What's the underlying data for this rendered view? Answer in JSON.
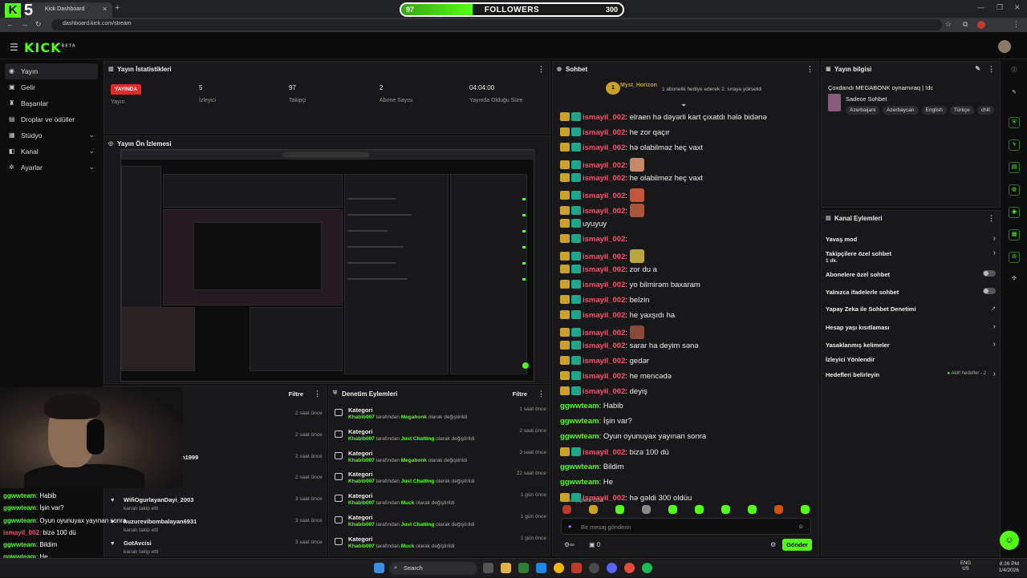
{
  "browser": {
    "tab_title": "Kick Dashboard",
    "url": "dashboard.kick.com/stream"
  },
  "overlay": {
    "logo_number": "5",
    "goal": {
      "current": "97",
      "label": "FOLLOWERS",
      "target": "300",
      "progress_fraction": 0.323
    }
  },
  "app": {
    "logo": "KICK",
    "logo_sup": "BETA"
  },
  "sidebar": {
    "items": [
      {
        "label": "Yayın",
        "icon": "broadcast-icon",
        "active": true
      },
      {
        "label": "Gelir",
        "icon": "money-icon"
      },
      {
        "label": "Başarılar",
        "icon": "trophy-icon"
      },
      {
        "label": "Droplar ve ödüller",
        "icon": "gift-icon"
      },
      {
        "label": "Stüdyo",
        "icon": "studio-icon",
        "expandable": true
      },
      {
        "label": "Kanal",
        "icon": "channel-icon",
        "expandable": true
      },
      {
        "label": "Ayarlar",
        "icon": "gear-icon",
        "expandable": true
      }
    ]
  },
  "stats": {
    "title": "Yayın İstatistikleri",
    "live_badge": "YAYINDA",
    "live_label": "Yayın",
    "viewers_value": "5",
    "viewers_label": "İzleyici",
    "followers_value": "97",
    "followers_label": "Takipçi",
    "subs_value": "2",
    "subs_label": "Abone Sayısı",
    "duration_value": "04:04:00",
    "duration_label": "Yayında Olduğu Süre"
  },
  "preview": {
    "title": "Yayın Ön İzlemesi"
  },
  "followers_panel": {
    "filter": "Filtre",
    "rows": [
      {
        "name": "",
        "sub": "",
        "time": "2 saat önce"
      },
      {
        "name": "",
        "sub": "",
        "time": "2 saat önce"
      },
      {
        "name": "n1999",
        "sub": "",
        "time": "2 saat önce"
      },
      {
        "name": "",
        "sub": "",
        "time": "2 saat önce"
      },
      {
        "name": "WifiOgurlayanDayi_2003",
        "sub": "kanalı takip etti",
        "time": "3 saat önce"
      },
      {
        "name": "huzurevibombalayan6931",
        "sub": "kanalı takip etti",
        "time": "3 saat önce"
      },
      {
        "name": "GotAvcisi",
        "sub": "kanalı takip etti",
        "time": "3 saat önce"
      }
    ]
  },
  "moderation": {
    "title": "Denetim Eylemleri",
    "filter": "Filtre",
    "rows": [
      {
        "title": "Kategori",
        "user": "Khabib007",
        "pre": " tarafından ",
        "cat": "Megabonk",
        "post": " olarak değiştirildi",
        "time": "1 saat önce"
      },
      {
        "title": "Kategori",
        "user": "Khabib007",
        "pre": " tarafından ",
        "cat": "Just Chatting",
        "post": " olarak değiştirildi",
        "time": "2 saat önce"
      },
      {
        "title": "Kategori",
        "user": "Khabib007",
        "pre": " tarafından ",
        "cat": "Megabonk",
        "post": " olarak değiştirildi",
        "time": "3 saat önce"
      },
      {
        "title": "Kategori",
        "user": "Khabib007",
        "pre": " tarafından ",
        "cat": "Just Chatting",
        "post": " olarak değiştirildi",
        "time": "22 saat önce"
      },
      {
        "title": "Kategori",
        "user": "Khabib007",
        "pre": " tarafından ",
        "cat": "Muck",
        "post": " olarak değiştirildi",
        "time": "1 gün önce"
      },
      {
        "title": "Kategori",
        "user": "Khabib007",
        "pre": " tarafından ",
        "cat": "Just Chatting",
        "post": " olarak değiştirildi",
        "time": "1 gün önce"
      },
      {
        "title": "Kategori",
        "user": "Khabib007",
        "pre": " tarafından ",
        "cat": "Muck",
        "post": " olarak değiştirildi",
        "time": "1 gün önce"
      }
    ]
  },
  "chat": {
    "title": "Sohbet",
    "pinned_user": "Myst_Horizon",
    "pinned_text": "1 abonelik hediye ederek 2. sıraya yükseldi",
    "pinned_rank": "1",
    "messages": [
      {
        "user": "ismayil_002",
        "text": ": elraen hə dəyərli kart çıxatdı hələ bidənə",
        "color": "red",
        "badges": true
      },
      {
        "user": "ismayil_002",
        "text": ": he zor qaçır",
        "color": "red",
        "badges": true
      },
      {
        "user": "ismayil_002",
        "text": ": hə olabilməz heç vaxt",
        "color": "red",
        "badges": true
      },
      {
        "user": "ismayil_002",
        "text": ":",
        "color": "red",
        "badges": true,
        "emote": "#c48a6a"
      },
      {
        "user": "ismayil_002",
        "text": ": he olabilmez heç vaxt",
        "color": "red",
        "badges": true
      },
      {
        "user": "ismayil_002",
        "text": ":",
        "color": "red",
        "badges": true,
        "emote": "#c4553a"
      },
      {
        "user": "ismayil_002",
        "text": ":",
        "color": "red",
        "badges": true,
        "emote": "#a8553a"
      },
      {
        "user": "",
        "text": "uyuyuy",
        "color": "red",
        "badges": true
      },
      {
        "user": "ismayil_002",
        "text": ":",
        "color": "red",
        "badges": true
      },
      {
        "user": "ismayil_002",
        "text": ":",
        "color": "red",
        "badges": true,
        "emote": "#b8a640"
      },
      {
        "user": "ismayil_002",
        "text": ": zor du a",
        "color": "red",
        "badges": true
      },
      {
        "user": "ismayil_002",
        "text": ": yo bilmirəm baxaram",
        "color": "red",
        "badges": true
      },
      {
        "user": "ismayil_002",
        "text": ": belzin",
        "color": "red",
        "badges": true
      },
      {
        "user": "ismayil_002",
        "text": ": he yaxşıdı ha",
        "color": "red",
        "badges": true
      },
      {
        "user": "ismayil_002",
        "text": ":",
        "color": "red",
        "badges": true,
        "emote": "#8a4a3a"
      },
      {
        "user": "ismayil_002",
        "text": ": sarar ha deyim sənə",
        "color": "red",
        "badges": true
      },
      {
        "user": "ismayil_002",
        "text": ": gedər",
        "color": "red",
        "badges": true
      },
      {
        "user": "ismayil_002",
        "text": ": he mencədə",
        "color": "red",
        "badges": true
      },
      {
        "user": "ismayil_002",
        "text": ": deyiş",
        "color": "red",
        "badges": true
      },
      {
        "user": "ggwwteam",
        "text": ": Habib",
        "color": "green",
        "badges": false
      },
      {
        "user": "ggwwteam",
        "text": ": İşin var?",
        "color": "green",
        "badges": false
      },
      {
        "user": "ggwwteam",
        "text": ": Oyun oyunuyax yayınan sonra",
        "color": "green",
        "badges": false
      },
      {
        "user": "ismayil_002",
        "text": ": bizə 100 dü",
        "color": "red",
        "badges": true
      },
      {
        "user": "ggwwteam",
        "text": ": Bildim",
        "color": "green",
        "badges": false
      },
      {
        "user": "ggwwteam",
        "text": ": He",
        "color": "green",
        "badges": false
      },
      {
        "user": "ismayil_002",
        "text": ": hə gəldi 300 oldüu",
        "color": "red",
        "badges": true
      }
    ],
    "followers_only": "Takipçilere Özel",
    "input_placeholder": "Bir mesaj gönderin",
    "send_label": "Gönder",
    "count": "0"
  },
  "overlay_chat": [
    {
      "user": "ggwwteam",
      "text": ": Habib",
      "color": "green"
    },
    {
      "user": "ggwwteam",
      "text": ": İşin var?",
      "color": "green"
    },
    {
      "user": "ggwwteam",
      "text": ": Oyun oyunuyax yayınan sonra",
      "color": "green"
    },
    {
      "user": "ismayil_002",
      "text": ": bizə 100 dü",
      "color": "red"
    },
    {
      "user": "ggwwteam",
      "text": ": Bildim",
      "color": "green"
    },
    {
      "user": "ggwwteam",
      "text": ": He",
      "color": "green"
    },
    {
      "user": "ismayil_002",
      "text": ": hə gəldi 300 oldüu",
      "color": "red"
    }
  ],
  "stream_info": {
    "title": "Yayın bilgisi",
    "stream_title": "Çoxdandı MEGABONK oynamıraq | !dc",
    "category": "Sadece Sohbet",
    "tags": [
      "Azerbaijani",
      "Azerbaycan",
      "English",
      "Türkçe",
      "chill"
    ]
  },
  "channel_actions": {
    "title": "Kanal Eylemleri",
    "items": [
      {
        "label": "Yavaş mod",
        "kind": "chevron"
      },
      {
        "label": "Takipçilere özel sohbet",
        "sub": "1 dk.",
        "kind": "chevron"
      },
      {
        "label": "Abonelere özel sohbet",
        "kind": "toggle"
      },
      {
        "label": "Yalnızca ifadelerle sohbet",
        "kind": "toggle"
      },
      {
        "label": "Yapay Zeka ile Sohbet Denetimi",
        "kind": "external"
      },
      {
        "label": "Hesap yaşı kısıtlaması",
        "kind": "chevron"
      },
      {
        "label": "Yasaklanmış kelimeler",
        "kind": "chevron"
      },
      {
        "label": "İzleyici Yönlendir",
        "kind": "none"
      },
      {
        "label": "Hedefleri belirleyin",
        "kind": "chevron",
        "extra": "Aktif hedefler - 2"
      }
    ]
  },
  "taskbar": {
    "search": "Search",
    "lang_top": "ENG",
    "lang_bottom": "US",
    "time": "8:26 PM",
    "date": "1/4/2026"
  }
}
